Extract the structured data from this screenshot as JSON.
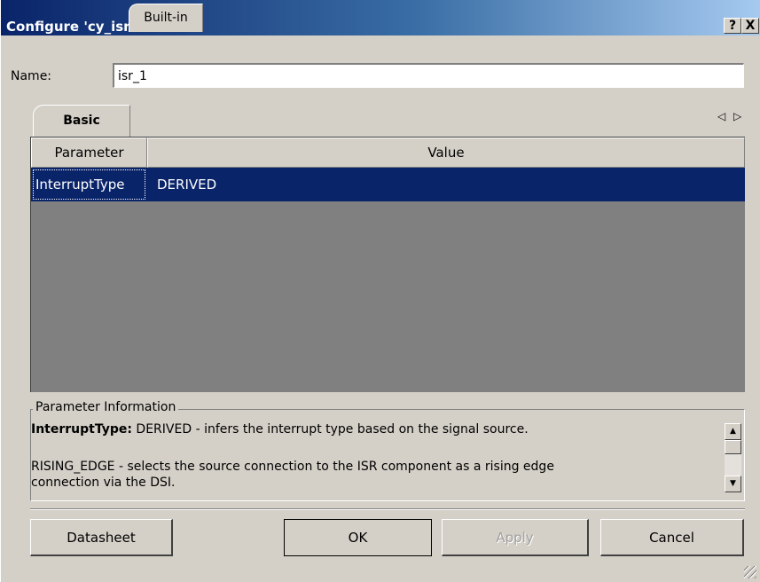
{
  "window": {
    "title": "Configure 'cy_isr'",
    "help_label": "?",
    "close_label": "X"
  },
  "name": {
    "label": "Name:",
    "value": "isr_1"
  },
  "tabs": [
    {
      "label": "Basic",
      "active": true
    },
    {
      "label": "Built-in",
      "active": false
    }
  ],
  "tab_scroll": {
    "left_icon": "◁",
    "right_icon": "▷"
  },
  "table": {
    "columns": [
      "Parameter",
      "Value"
    ],
    "rows": [
      {
        "parameter": "InterruptType",
        "value": "DERIVED",
        "selected": true
      }
    ]
  },
  "parameter_info": {
    "legend": "Parameter Information",
    "bold_label": "InterruptType:",
    "line1_rest": " DERIVED - infers the interrupt type based on the signal source.",
    "line2": "RISING_EDGE - selects the source connection to the ISR component as a rising edge",
    "line3": "connection via the DSI."
  },
  "buttons": {
    "datasheet": "Datasheet",
    "ok": "OK",
    "apply": "Apply",
    "cancel": "Cancel"
  },
  "colors": {
    "selection": "#0a246a",
    "dialog_bg": "#d4d0c8",
    "grid_bg": "#808080"
  }
}
